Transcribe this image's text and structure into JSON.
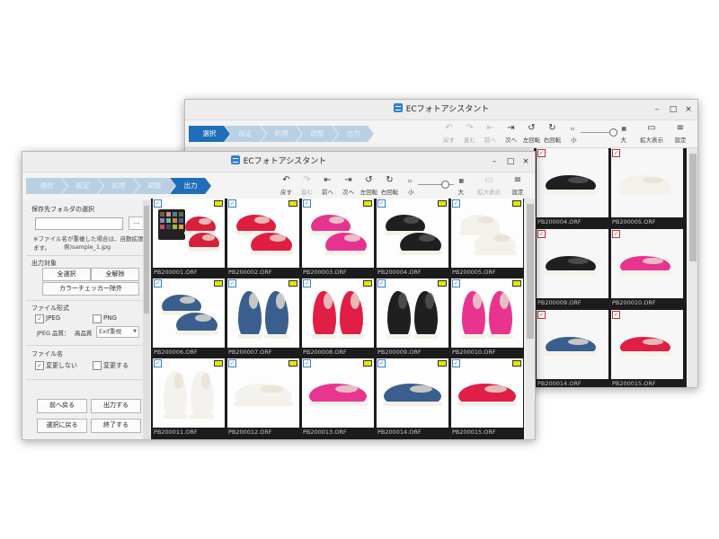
{
  "app": {
    "title": "ECフォトアシスタント"
  },
  "window_controls": {
    "minimize": "–",
    "maximize": "□",
    "close": "×"
  },
  "steps": [
    "選択",
    "設定",
    "処理",
    "調整",
    "出力"
  ],
  "back_window": {
    "active_step": "選択"
  },
  "front_window": {
    "active_step": "出力"
  },
  "toolbar": {
    "undo": "戻す",
    "redo": "進む",
    "prev": "前へ",
    "next": "次へ",
    "rotate_left": "左回転",
    "rotate_right": "右回転",
    "zoom_small": "小",
    "zoom_large": "大",
    "enlarge": "拡大表示",
    "settings": "設定"
  },
  "panel": {
    "save_folder_label": "保存先フォルダの選択",
    "browse_button": "...",
    "note_line1": "※ファイル名が重複した場合は、自動拡張します。",
    "note_line2": "例)sample_1.jpg",
    "output_target_label": "出力対象",
    "select_all": "全選択",
    "deselect_all": "全解除",
    "exclude_color_checker": "カラーチェッカー除外",
    "file_format_label": "ファイル形式",
    "jpeg": "JPEG",
    "png": "PNG",
    "jpeg_quality_label": "JPEG 品質：",
    "quality_high": "高品質",
    "exif": "Exif重視",
    "filename_label": "ファイル名",
    "no_change": "変更しない",
    "change": "変更する",
    "back_button": "前へ戻る",
    "output_button": "出力する",
    "return_select_button": "選択に戻る",
    "finish_button": "終了する"
  },
  "front_thumbs": [
    {
      "name": "PB200001.ORF",
      "kind": "checker",
      "color": "#d8203a"
    },
    {
      "name": "PB200002.ORF",
      "kind": "pair",
      "color": "#e01e40"
    },
    {
      "name": "PB200003.ORF",
      "kind": "pair",
      "color": "#e6338f"
    },
    {
      "name": "PB200004.ORF",
      "kind": "pair",
      "color": "#1f1f1f"
    },
    {
      "name": "PB200005.ORF",
      "kind": "pair",
      "color": "#f3f1ec"
    },
    {
      "name": "PB200006.ORF",
      "kind": "pair",
      "color": "#3a5f8e"
    },
    {
      "name": "PB200007.ORF",
      "kind": "front",
      "color": "#3a5f8e"
    },
    {
      "name": "PB200008.ORF",
      "kind": "front",
      "color": "#e11e45"
    },
    {
      "name": "PB200009.ORF",
      "kind": "front",
      "color": "#1f1f1f"
    },
    {
      "name": "PB200010.ORF",
      "kind": "front",
      "color": "#e9348f"
    },
    {
      "name": "PB200011.ORF",
      "kind": "front",
      "color": "#f4f2ee"
    },
    {
      "name": "PB200012.ORF",
      "kind": "side",
      "color": "#f4f2ee"
    },
    {
      "name": "PB200013.ORF",
      "kind": "side",
      "color": "#e83590"
    },
    {
      "name": "PB200014.ORF",
      "kind": "side",
      "color": "#3a5f8e"
    },
    {
      "name": "PB200015.ORF",
      "kind": "side",
      "color": "#e11e45"
    }
  ],
  "back_thumbs": [
    {
      "name": "PB200004.ORF",
      "kind": "single",
      "color": "#1f1f1f"
    },
    {
      "name": "PB200005.ORF",
      "kind": "single",
      "color": "#f3f1ec"
    },
    {
      "name": "PB200009.ORF",
      "kind": "single",
      "color": "#1f1f1f"
    },
    {
      "name": "PB200010.ORF",
      "kind": "single",
      "color": "#e9348f"
    },
    {
      "name": "PB200014.ORF",
      "kind": "single",
      "color": "#3a5f8e"
    },
    {
      "name": "PB200015.ORF",
      "kind": "single",
      "color": "#e11e45"
    }
  ],
  "colors": {
    "accent": "#1e6fb8",
    "step_inactive": "#b9d0e3",
    "grid_bg": "#1c1c1c"
  }
}
